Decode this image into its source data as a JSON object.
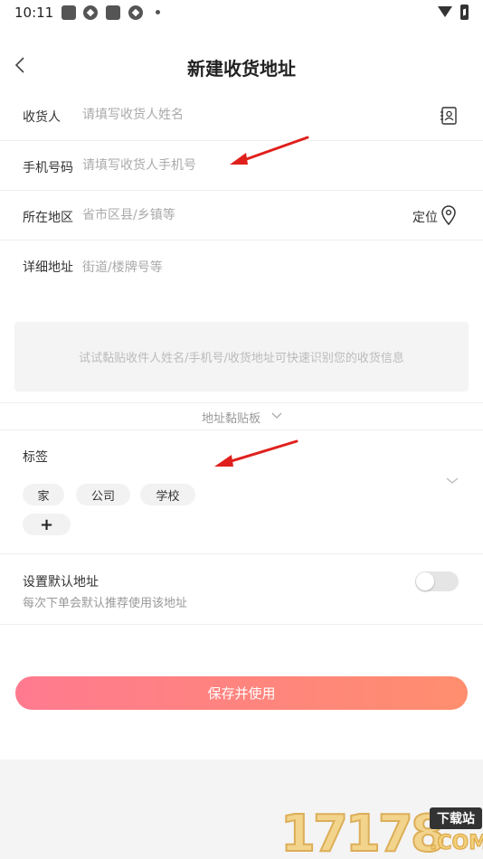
{
  "status_bar": {
    "time": "10:11",
    "notification_icons": [
      "square-icon",
      "aperture-icon",
      "square-icon",
      "aperture-icon",
      "dot-icon"
    ],
    "right_icons": [
      "wifi-icon",
      "battery-charging-icon"
    ]
  },
  "header": {
    "title": "新建收货地址",
    "back_icon": "chevron-left-icon"
  },
  "form": {
    "receiver": {
      "label": "收货人",
      "placeholder": "请填写收货人姓名",
      "icon": "contacts-book-icon"
    },
    "phone": {
      "label": "手机号码",
      "placeholder": "请填写收货人手机号"
    },
    "region": {
      "label": "所在地区",
      "placeholder": "省市区县/乡镇等",
      "locate_label": "定位",
      "icon": "location-pin-icon"
    },
    "detail": {
      "label": "详细地址",
      "placeholder": "街道/楼牌号等"
    }
  },
  "paste": {
    "hint": "试试黏贴收件人姓名/手机号/收货地址可快速识别您的收货信息",
    "clipboard_label": "地址黏贴板",
    "clipboard_icon": "chevron-down-icon"
  },
  "tags": {
    "title": "标签",
    "items": [
      "家",
      "公司",
      "学校"
    ],
    "add_label": "+"
  },
  "default_address": {
    "title": "设置默认地址",
    "subtitle": "每次下单会默认推荐使用该地址",
    "enabled": false
  },
  "actions": {
    "save_label": "保存并使用"
  },
  "watermark": {
    "number": "17178",
    "badge": "下载站",
    "domain": ".COM"
  },
  "colors": {
    "button_gradient_start": "#ff7a8f",
    "button_gradient_end": "#ff8e6e",
    "annotation_arrow": "#e0201c",
    "placeholder": "#aaaaaa"
  }
}
